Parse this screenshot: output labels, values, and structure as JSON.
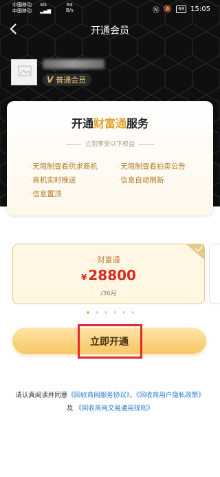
{
  "status_bar": {
    "carrier1": "中国移动",
    "carrier2": "中国移动",
    "network": "4G",
    "speed_value": "64",
    "speed_unit": "B/s",
    "battery": "68",
    "time": "15:05"
  },
  "header": {
    "title": "开通会员"
  },
  "profile": {
    "membership_badge": "普通会员",
    "badge_mark": "V"
  },
  "benefits_card": {
    "title_prefix": "开通",
    "title_highlight": "财富通",
    "title_suffix": "服务",
    "subtitle": "立刻享受以下权益",
    "items": [
      "无限制查看供求商机",
      "无限制查看拍卖公告",
      "商机实时推送",
      "信息自动刷新",
      "信息置顶"
    ]
  },
  "plan": {
    "name": "财富通",
    "currency": "¥",
    "price": "28800",
    "period": "/36月"
  },
  "actions": {
    "open_label": "立即开通"
  },
  "agreement": {
    "prefix": "请认真阅读并同意",
    "link1": "《回收商网服务协议》",
    "sep": "、",
    "link2": "《回收商用户隐私政策》",
    "and": "及",
    "link3": "《回收商网交易通用规则》"
  },
  "colors": {
    "accent_gold": "#e0a32e",
    "price_red": "#d92b1f",
    "link_blue": "#2b7bd3",
    "header_bg": "#0f0f10"
  }
}
